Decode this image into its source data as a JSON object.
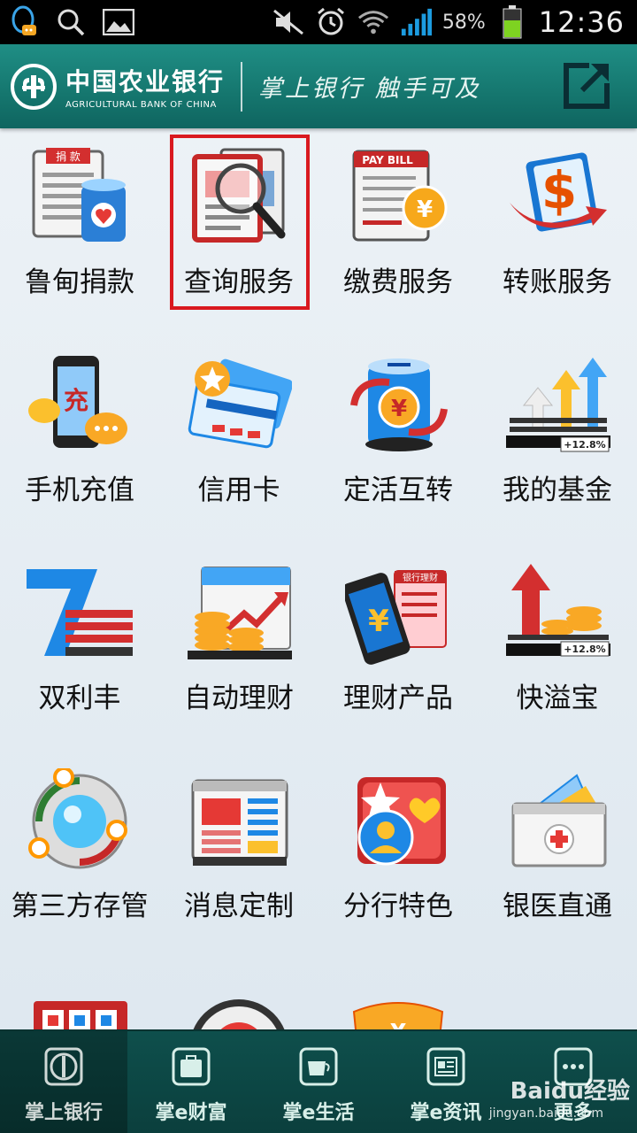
{
  "status_bar": {
    "battery": "58%",
    "time": "12:36"
  },
  "header": {
    "brand_cn": "中国农业银行",
    "brand_en": "AGRICULTURAL BANK OF CHINA",
    "slogan": "掌上银行 触手可及"
  },
  "grid": {
    "tiles": [
      {
        "label": "鲁甸捐款",
        "icon": "donation-icon",
        "badge": "捐 款"
      },
      {
        "label": "查询服务",
        "icon": "query-service-icon"
      },
      {
        "label": "缴费服务",
        "icon": "bill-payment-icon",
        "badge": "PAY BILL"
      },
      {
        "label": "转账服务",
        "icon": "transfer-icon"
      },
      {
        "label": "手机充值",
        "icon": "phone-topup-icon",
        "badge": "充"
      },
      {
        "label": "信用卡",
        "icon": "credit-card-icon"
      },
      {
        "label": "定活互转",
        "icon": "deposit-convert-icon"
      },
      {
        "label": "我的基金",
        "icon": "fund-icon",
        "badge": "+12.8%"
      },
      {
        "label": "双利丰",
        "icon": "shuanglifeng-icon"
      },
      {
        "label": "自动理财",
        "icon": "auto-finance-icon"
      },
      {
        "label": "理财产品",
        "icon": "finance-products-icon",
        "badge": "银行理财"
      },
      {
        "label": "快溢宝",
        "icon": "kuaiyibao-icon",
        "badge": "+12.8%"
      },
      {
        "label": "第三方存管",
        "icon": "third-party-custody-icon"
      },
      {
        "label": "消息定制",
        "icon": "message-custom-icon"
      },
      {
        "label": "分行特色",
        "icon": "branch-feature-icon"
      },
      {
        "label": "银医直通",
        "icon": "bank-hospital-icon"
      }
    ]
  },
  "bottom_nav": [
    {
      "label": "掌上银行",
      "icon": "bank-logo-icon",
      "active": true
    },
    {
      "label": "掌e财富",
      "icon": "briefcase-icon",
      "active": false
    },
    {
      "label": "掌e生活",
      "icon": "coffee-cup-icon",
      "active": false
    },
    {
      "label": "掌e资讯",
      "icon": "news-icon",
      "active": false
    },
    {
      "label": "更多",
      "icon": "more-icon",
      "active": false
    }
  ],
  "watermark": {
    "text": "Baidu经验",
    "url": "jingyan.baidu.com"
  }
}
